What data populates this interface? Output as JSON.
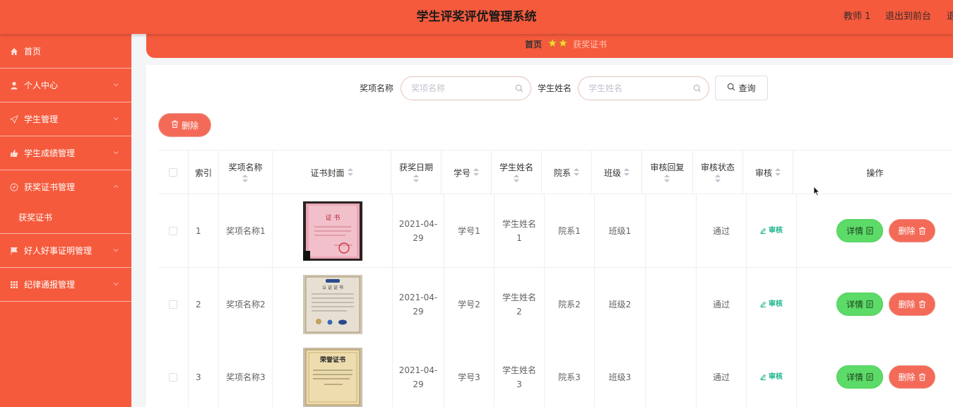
{
  "header": {
    "title": "学生评奖评优管理系统",
    "user": "教师 1",
    "front_link": "退出到前台",
    "logout_link": "退出登录"
  },
  "sidebar": {
    "items": [
      {
        "label": "首页",
        "icon": "home-icon",
        "arrow": "none"
      },
      {
        "label": "个人中心",
        "icon": "user-icon",
        "arrow": "down"
      },
      {
        "label": "学生管理",
        "icon": "send-icon",
        "arrow": "down"
      },
      {
        "label": "学生成绩管理",
        "icon": "thumbs-up-icon",
        "arrow": "down"
      },
      {
        "label": "获奖证书管理",
        "icon": "compass-icon",
        "arrow": "up"
      },
      {
        "label": "好人好事证明管理",
        "icon": "flag-icon",
        "arrow": "down"
      },
      {
        "label": "纪律通报管理",
        "icon": "grid-icon",
        "arrow": "down"
      }
    ],
    "active_sub": "获奖证书"
  },
  "breadcrumb": {
    "home": "首页",
    "current": "获奖证书"
  },
  "search": {
    "award_label": "奖项名称",
    "award_placeholder": "奖项名称",
    "student_label": "学生姓名",
    "student_placeholder": "学生姓名",
    "query_button": "查询"
  },
  "toolbar": {
    "delete_button": "删除"
  },
  "table": {
    "headers": {
      "index": "索引",
      "award_name": "奖项名称",
      "cover": "证书封面",
      "date": "获奖日期",
      "student_no": "学号",
      "student_name": "学生姓名",
      "department": "院系",
      "class": "班级",
      "reply": "审核回复",
      "status": "审核状态",
      "audit": "审核",
      "actions": "操作"
    },
    "rows": [
      {
        "index": "1",
        "award_name": "奖项名称1",
        "date": "2021-04-29",
        "student_no": "学号1",
        "student_name": "学生姓名1",
        "department": "院系1",
        "class": "班级1",
        "reply": "",
        "status": "通过",
        "audit": "审核",
        "cover": "pink"
      },
      {
        "index": "2",
        "award_name": "奖项名称2",
        "date": "2021-04-29",
        "student_no": "学号2",
        "student_name": "学生姓名2",
        "department": "院系2",
        "class": "班级2",
        "reply": "",
        "status": "通过",
        "audit": "审核",
        "cover": "white"
      },
      {
        "index": "3",
        "award_name": "奖项名称3",
        "date": "2021-04-29",
        "student_no": "学号3",
        "student_name": "学生姓名3",
        "department": "院系3",
        "class": "班级3",
        "reply": "",
        "status": "通过",
        "audit": "审核",
        "cover": "gold"
      }
    ],
    "detail_button": "详情",
    "delete_button": "删除"
  },
  "colors": {
    "brand": "#f55a3c",
    "success": "#5cdb68",
    "danger": "#f46a58",
    "audit_link": "#19b48c"
  }
}
